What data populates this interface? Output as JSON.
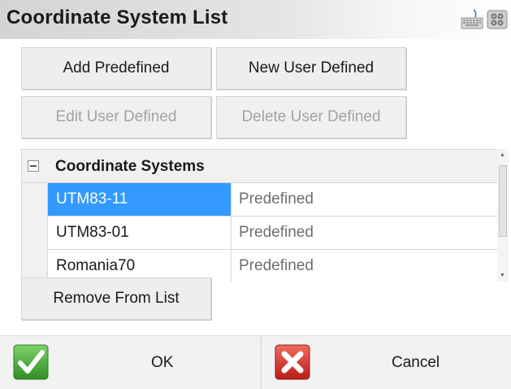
{
  "window": {
    "title": "Coordinate System List"
  },
  "toolbar": {
    "add_predefined": "Add Predefined",
    "new_user_defined": "New User Defined",
    "edit_user_defined": "Edit User Defined",
    "delete_user_defined": "Delete User Defined"
  },
  "grid": {
    "header": "Coordinate Systems",
    "rows": [
      {
        "name": "UTM83-11",
        "type": "Predefined",
        "selected": true
      },
      {
        "name": "UTM83-01",
        "type": "Predefined",
        "selected": false
      },
      {
        "name": "Romania70",
        "type": "Predefined",
        "selected": false
      }
    ]
  },
  "actions": {
    "remove_from_list": "Remove From List"
  },
  "footer": {
    "ok": "OK",
    "cancel": "Cancel"
  },
  "icons": {
    "keyboard": "keyboard-icon",
    "settings": "settings-icon",
    "ok": "checkmark-icon",
    "cancel": "cancel-x-icon",
    "collapse": "collapse-icon"
  },
  "colors": {
    "selection": "#3399ff",
    "ok_green": "#3fa52e",
    "cancel_red": "#d9302a",
    "disabled_text": "#a3a3a3"
  }
}
